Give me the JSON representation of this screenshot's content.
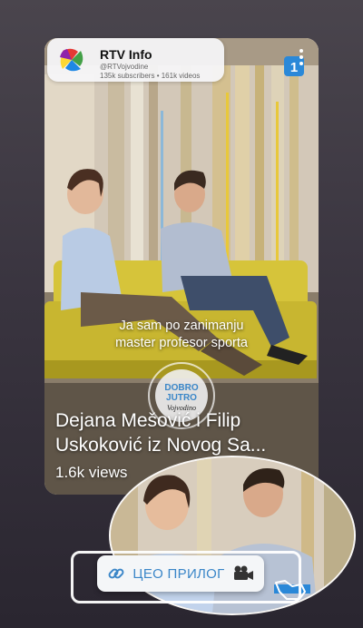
{
  "channel": {
    "name": "RTV Info",
    "handle": "@RTVojvodine",
    "stats": "135k subscribers • 161k videos"
  },
  "video": {
    "caption_line1": "Ja sam po zanimanju",
    "caption_line2": "master profesor sporta",
    "title_line1": "Dejana Mešović i Filip",
    "title_line2": "Uskoković iz Novog Sa...",
    "views": "1.6k views",
    "show_logo": "DOBRO JUTRO Vojvodino",
    "channel_badge": "1"
  },
  "cta": {
    "label": "ЦЕО ПРИЛОГ"
  },
  "icons": {
    "link": "link-icon",
    "camera": "movie-camera-icon",
    "more": "more-vert-icon",
    "pointer": "pointer-hand-icon"
  },
  "colors": {
    "cta_text": "#3a86c8",
    "sofa": "#d6c43a",
    "accent_blue": "#2a88d8"
  }
}
